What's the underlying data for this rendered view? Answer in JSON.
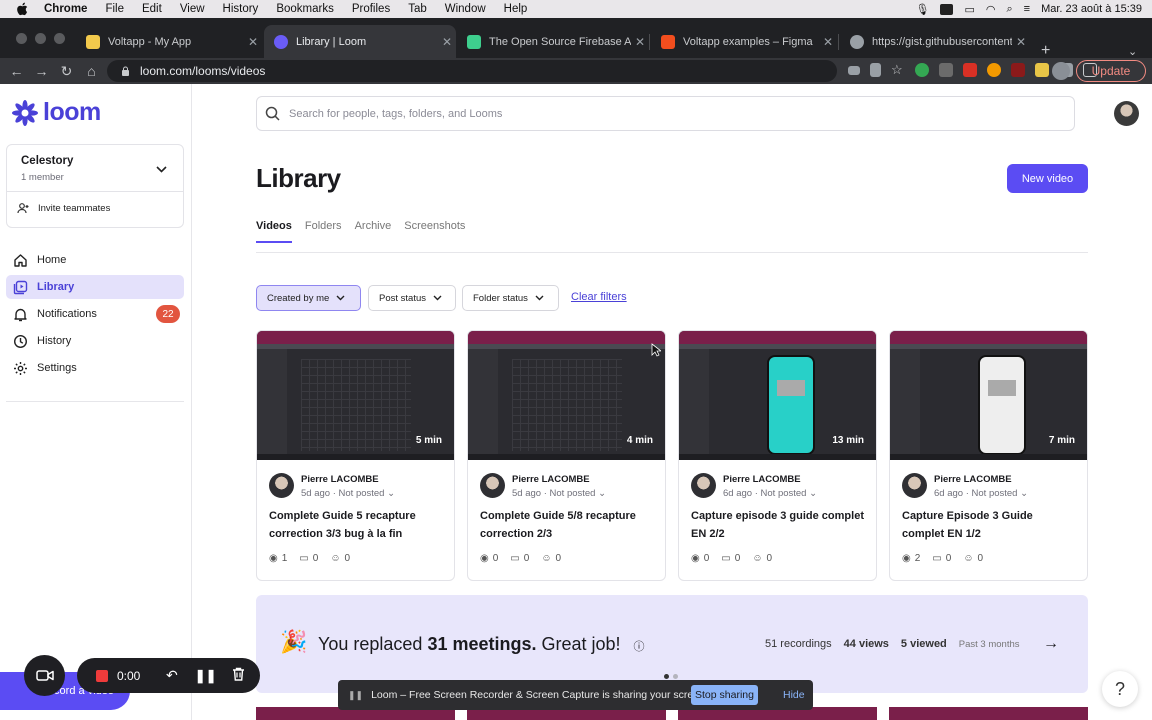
{
  "menubar": {
    "app": "Chrome",
    "items": [
      "File",
      "Edit",
      "View",
      "History",
      "Bookmarks",
      "Profiles",
      "Tab",
      "Window",
      "Help"
    ],
    "clock": "Mar. 23 août à  15:39"
  },
  "browser": {
    "tabs": [
      {
        "title": "Voltapp - My App",
        "color": "#f2c94c"
      },
      {
        "title": "Library | Loom",
        "color": "#6a5cf6"
      },
      {
        "title": "The Open Source Firebase Alte",
        "color": "#3ecf8e"
      },
      {
        "title": "Voltapp examples – Figma",
        "color": "#f24e1e"
      },
      {
        "title": "https://gist.githubusercontent...",
        "color": "#9aa0a6"
      }
    ],
    "url": "loom.com/looms/videos",
    "update_label": "Update"
  },
  "sidebar": {
    "logo_text": "loom",
    "workspace_name": "Celestory",
    "workspace_members": "1 member",
    "invite_label": "Invite teammates",
    "items": [
      {
        "label": "Home",
        "icon": "home-icon"
      },
      {
        "label": "Library",
        "icon": "library-icon"
      },
      {
        "label": "Notifications",
        "icon": "bell-icon",
        "badge": "22"
      },
      {
        "label": "History",
        "icon": "history-icon"
      },
      {
        "label": "Settings",
        "icon": "gear-icon"
      }
    ]
  },
  "main": {
    "search_placeholder": "Search for people, tags, folders, and Looms",
    "title": "Library",
    "new_video_label": "New video",
    "tabs": [
      "Videos",
      "Folders",
      "Archive",
      "Screenshots"
    ],
    "filters": [
      "Created by me",
      "Post status",
      "Folder status"
    ],
    "clear_filters": "Clear filters",
    "videos": [
      {
        "duration": "5 min",
        "author": "Pierre LACOMBE",
        "ago": "5d ago",
        "status": "Not posted",
        "title": "Complete Guide 5 recapture correction 3/3 bug à la fin",
        "views": "1",
        "comments": "0",
        "reactions": "0",
        "thumb": "grid"
      },
      {
        "duration": "4 min",
        "author": "Pierre LACOMBE",
        "ago": "5d ago",
        "status": "Not posted",
        "title": "Complete Guide 5/8 recapture correction 2/3",
        "views": "0",
        "comments": "0",
        "reactions": "0",
        "thumb": "grid"
      },
      {
        "duration": "13 min",
        "author": "Pierre LACOMBE",
        "ago": "6d ago",
        "status": "Not posted",
        "title": "Capture episode 3 guide complet EN 2/2",
        "views": "0",
        "comments": "0",
        "reactions": "0",
        "thumb": "phone-teal"
      },
      {
        "duration": "7 min",
        "author": "Pierre LACOMBE",
        "ago": "6d ago",
        "status": "Not posted",
        "title": "Capture Episode 3 Guide complet EN 1/2",
        "views": "2",
        "comments": "0",
        "reactions": "0",
        "thumb": "phone-white"
      }
    ],
    "banner": {
      "emoji": "🎉",
      "text_before": "You replaced ",
      "text_bold": "31 meetings.",
      "text_after": " Great job!",
      "recordings": "51 recordings",
      "views": "44 views",
      "viewed": "5 viewed",
      "period": "Past 3 months"
    }
  },
  "recorder": {
    "record_label": "Record a video",
    "timer": "0:00"
  },
  "share_bar": {
    "message": "Loom – Free Screen Recorder & Screen Capture is sharing your screen.",
    "stop_label": "Stop sharing",
    "hide_label": "Hide"
  },
  "help_label": "?"
}
